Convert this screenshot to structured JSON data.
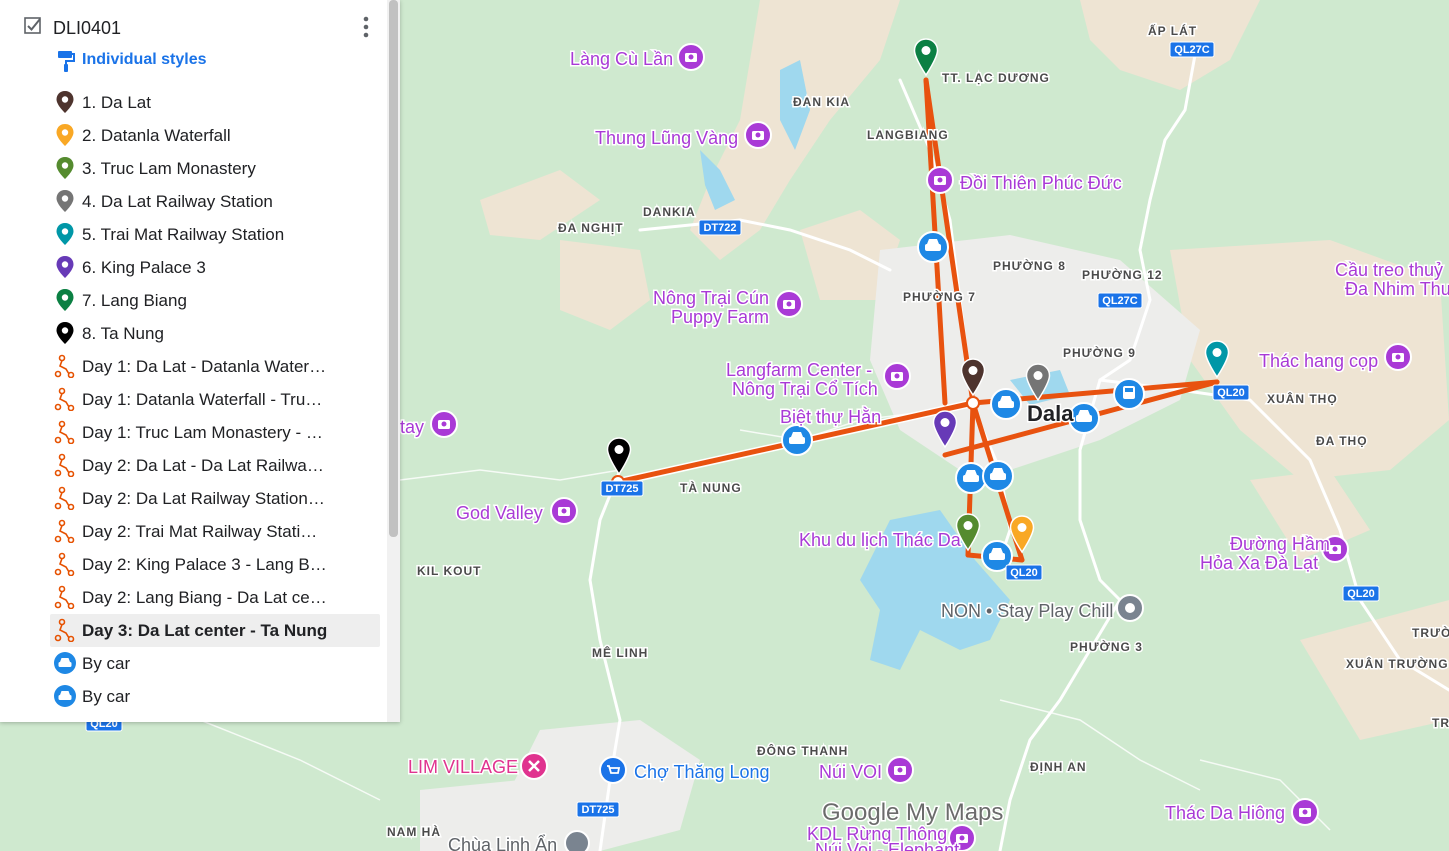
{
  "layer": {
    "title": "DLI0401",
    "styles_label": "Individual styles"
  },
  "items": [
    {
      "label": "1. Da Lat",
      "kind": "pin",
      "color": "#4e342e"
    },
    {
      "label": "2. Datanla Waterfall",
      "kind": "pin",
      "color": "#f9a825"
    },
    {
      "label": "3. Truc Lam Monastery",
      "kind": "pin",
      "color": "#558b2f"
    },
    {
      "label": "4. Da Lat Railway Station",
      "kind": "pin",
      "color": "#757575"
    },
    {
      "label": "5. Trai Mat Railway Station",
      "kind": "pin",
      "color": "#0097a7"
    },
    {
      "label": "6. King Palace 3",
      "kind": "pin",
      "color": "#673ab7"
    },
    {
      "label": "7. Lang Biang",
      "kind": "pin",
      "color": "#0b8043"
    },
    {
      "label": "8. Ta Nung",
      "kind": "pin",
      "color": "#000000"
    },
    {
      "label": "Day 1: Da Lat - Datanla Water…",
      "kind": "route",
      "color": "#e65100"
    },
    {
      "label": "Day 1: Datanla Waterfall - Tru…",
      "kind": "route",
      "color": "#e65100"
    },
    {
      "label": "Day 1: Truc Lam Monastery - …",
      "kind": "route",
      "color": "#e65100"
    },
    {
      "label": "Day 2: Da Lat - Da Lat Railwa…",
      "kind": "route",
      "color": "#e65100"
    },
    {
      "label": "Day 2: Da Lat Railway Station…",
      "kind": "route",
      "color": "#e65100"
    },
    {
      "label": "Day 2: Trai Mat Railway Stati…",
      "kind": "route",
      "color": "#e65100"
    },
    {
      "label": "Day 2: King Palace 3 - Lang B…",
      "kind": "route",
      "color": "#e65100"
    },
    {
      "label": "Day 2: Lang Biang - Da Lat ce…",
      "kind": "route",
      "color": "#e65100"
    },
    {
      "label": "Day 3: Da Lat center - Ta Nung",
      "kind": "route",
      "color": "#e65100",
      "selected": true
    },
    {
      "label": "By car",
      "kind": "car",
      "color": "#1e88e5"
    },
    {
      "label": "By car",
      "kind": "car",
      "color": "#1e88e5"
    }
  ],
  "map": {
    "colors": {
      "route": "#e8520f",
      "poi": "#a93ad6",
      "road_shield": "#1a73e8",
      "car": "#1e88e5"
    },
    "place_labels": [
      "ẤP LÁT",
      "TT. LẠC DƯƠNG",
      "ĐAN KIA",
      "LANGBIANG",
      "DANKIA",
      "ĐA NGHỊT",
      "PHƯỜNG 8",
      "PHƯỜNG 12",
      "PHƯỜNG 7",
      "PHƯỜNG 9",
      "Dala",
      "XUÂN THỌ",
      "ĐA THỌ",
      "TÀ NUNG",
      "KIL KOUT",
      "PHƯỜNG 3",
      "MÊ LINH",
      "XUÂN TRƯỜNG",
      "ĐÔNG THANH",
      "ĐỊNH AN",
      "NAM HÀ",
      "TRƯỜ",
      "TR",
      "tay"
    ],
    "poi_labels": [
      "Làng Cù Lần",
      "Thung Lũng Vàng",
      "Đồi Thiên Phúc Đức",
      "Nông Trại Cún",
      "Puppy Farm",
      "Langfarm Center -",
      "Nông Trại Cổ Tích",
      "Biệt thự Hằn",
      "Cầu treo thuỷ",
      "Đa Nhim Thu",
      "Thác hang cọp",
      "God Valley",
      "Khu du lịch Thác Da",
      "Đường Hầm",
      "Hỏa Xa Đà Lạt",
      "NON • Stay Play Chill",
      "LIM VILLAGE",
      "Chợ Thăng Long",
      "Núi VOI",
      "Thác Da Hiông",
      "KDL Rừng Thông",
      "Núi Voi - Elephant",
      "Chùa Linh Ẩn"
    ],
    "road_shields": [
      "QL27C",
      "DT722",
      "QL27C",
      "QL20",
      "DT725",
      "QL20",
      "QL20",
      "DT725",
      "QL20"
    ],
    "watermark": "Google My Maps"
  }
}
